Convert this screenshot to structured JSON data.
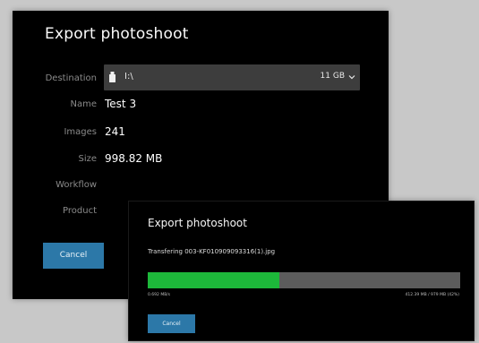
{
  "colors": {
    "background": "#c8c8c8",
    "dialog": "#000000",
    "accent_button": "#2c78a8",
    "progress_fill": "#1db83a",
    "progress_track": "#5c5c5c"
  },
  "export_dialog": {
    "title": "Export photoshoot",
    "destination": {
      "label": "Destination",
      "icon": "usb-drive-icon",
      "path": "I:\\",
      "size": "11 GB"
    },
    "name": {
      "label": "Name",
      "value": "Test 3"
    },
    "images": {
      "label": "Images",
      "value": "241"
    },
    "size": {
      "label": "Size",
      "value": "998.82 MB"
    },
    "workflow": {
      "label": "Workflow"
    },
    "product": {
      "label": "Product"
    },
    "cancel_label": "Cancel"
  },
  "progress_dialog": {
    "title": "Export photoshoot",
    "status": "Transfering 003-KF010909093316(1).jpg",
    "progress_fraction": 0.42,
    "speed": "0.692 MB/s",
    "amount": "412.39 MB / 979 MB (42%)",
    "cancel_label": "Cancel"
  }
}
